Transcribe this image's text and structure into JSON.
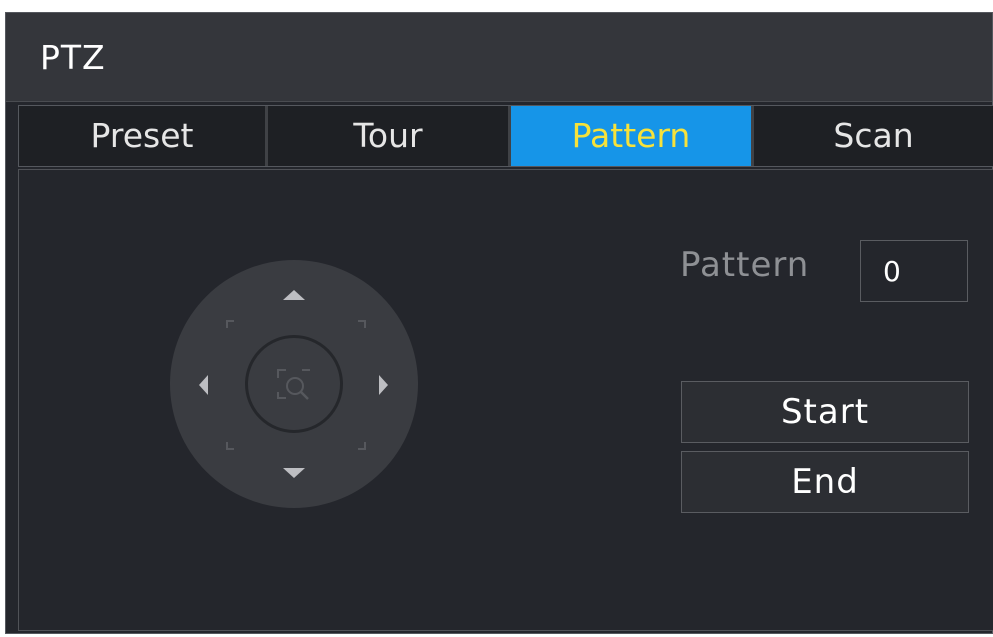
{
  "window": {
    "title": "PTZ"
  },
  "tabs": [
    {
      "label": "Preset",
      "active": false
    },
    {
      "label": "Tour",
      "active": false
    },
    {
      "label": "Pattern",
      "active": true
    },
    {
      "label": "Scan",
      "active": false
    }
  ],
  "pattern": {
    "label": "Pattern",
    "value": "0"
  },
  "buttons": {
    "start_label": "Start",
    "end_label": "End"
  },
  "dpad": {
    "icons": [
      "arrow-up-icon",
      "arrow-down-icon",
      "arrow-left-icon",
      "arrow-right-icon",
      "zoom-icon"
    ]
  },
  "colors": {
    "accent": "#1695e8",
    "active_tab_text": "#f7e23a",
    "background": "#24262c"
  }
}
